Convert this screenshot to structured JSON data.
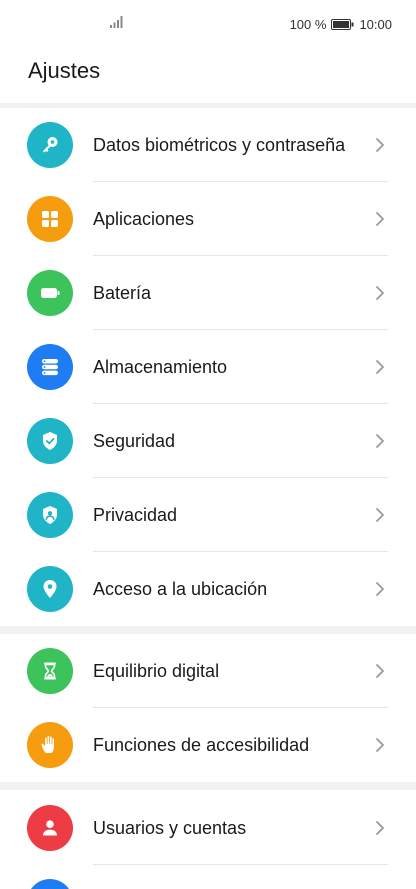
{
  "status_bar": {
    "battery_percent": "100 %",
    "time": "10:00",
    "icons": [
      "signal-icon",
      "battery-icon"
    ]
  },
  "title": "Ajustes",
  "groups": [
    {
      "items": [
        {
          "label": "Datos biométricos y contraseña",
          "icon": "key-icon",
          "color": "#1fb5c7"
        },
        {
          "label": "Aplicaciones",
          "icon": "apps-grid-icon",
          "color": "#f59d0e"
        },
        {
          "label": "Batería",
          "icon": "battery-icon",
          "color": "#3cc35b"
        },
        {
          "label": "Almacenamiento",
          "icon": "storage-icon",
          "color": "#1f7cf2"
        },
        {
          "label": "Seguridad",
          "icon": "shield-check-icon",
          "color": "#1fb5c7"
        },
        {
          "label": "Privacidad",
          "icon": "privacy-shield-icon",
          "color": "#1fb5c7"
        },
        {
          "label": "Acceso a la ubicación",
          "icon": "location-pin-icon",
          "color": "#1fb5c7"
        }
      ]
    },
    {
      "items": [
        {
          "label": "Equilibrio digital",
          "icon": "hourglass-icon",
          "color": "#3cc35b"
        },
        {
          "label": "Funciones de accesibilidad",
          "icon": "hand-icon",
          "color": "#f59d0e"
        }
      ]
    },
    {
      "items": [
        {
          "label": "Usuarios y cuentas",
          "icon": "user-icon",
          "color": "#ee3c44"
        }
      ]
    }
  ]
}
